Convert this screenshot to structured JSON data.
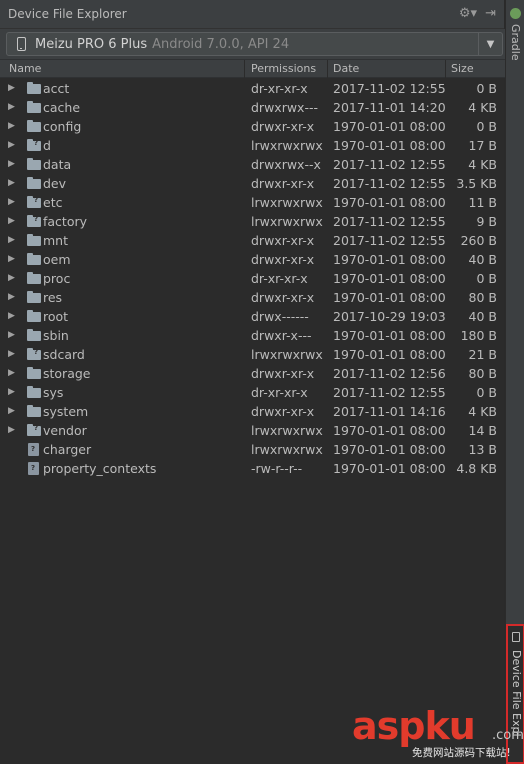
{
  "window": {
    "title": "Device File Explorer",
    "gear_icon": "⚙▾",
    "pin_icon": "⇥"
  },
  "device": {
    "name": "Meizu PRO 6 Plus",
    "version": "Android 7.0.0, API 24",
    "dropdown_icon": "▼"
  },
  "columns": {
    "name": "Name",
    "permissions": "Permissions",
    "date": "Date",
    "size": "Size"
  },
  "files": [
    {
      "name": "acct",
      "permissions": "dr-xr-xr-x",
      "date": "2017-11-02 12:55",
      "size": "0 B",
      "kind": "folder"
    },
    {
      "name": "cache",
      "permissions": "drwxrwx---",
      "date": "2017-11-01 14:20",
      "size": "4 KB",
      "kind": "folder"
    },
    {
      "name": "config",
      "permissions": "drwxr-xr-x",
      "date": "1970-01-01 08:00",
      "size": "0 B",
      "kind": "folder"
    },
    {
      "name": "d",
      "permissions": "lrwxrwxrwx",
      "date": "1970-01-01 08:00",
      "size": "17 B",
      "kind": "link"
    },
    {
      "name": "data",
      "permissions": "drwxrwx--x",
      "date": "2017-11-02 12:55",
      "size": "4 KB",
      "kind": "folder"
    },
    {
      "name": "dev",
      "permissions": "drwxr-xr-x",
      "date": "2017-11-02 12:55",
      "size": "3.5 KB",
      "kind": "folder"
    },
    {
      "name": "etc",
      "permissions": "lrwxrwxrwx",
      "date": "1970-01-01 08:00",
      "size": "11 B",
      "kind": "link"
    },
    {
      "name": "factory",
      "permissions": "lrwxrwxrwx",
      "date": "2017-11-02 12:55",
      "size": "9 B",
      "kind": "link"
    },
    {
      "name": "mnt",
      "permissions": "drwxr-xr-x",
      "date": "2017-11-02 12:55",
      "size": "260 B",
      "kind": "folder"
    },
    {
      "name": "oem",
      "permissions": "drwxr-xr-x",
      "date": "1970-01-01 08:00",
      "size": "40 B",
      "kind": "folder"
    },
    {
      "name": "proc",
      "permissions": "dr-xr-xr-x",
      "date": "1970-01-01 08:00",
      "size": "0 B",
      "kind": "folder"
    },
    {
      "name": "res",
      "permissions": "drwxr-xr-x",
      "date": "1970-01-01 08:00",
      "size": "80 B",
      "kind": "folder"
    },
    {
      "name": "root",
      "permissions": "drwx------",
      "date": "2017-10-29 19:03",
      "size": "40 B",
      "kind": "folder"
    },
    {
      "name": "sbin",
      "permissions": "drwxr-x---",
      "date": "1970-01-01 08:00",
      "size": "180 B",
      "kind": "folder"
    },
    {
      "name": "sdcard",
      "permissions": "lrwxrwxrwx",
      "date": "1970-01-01 08:00",
      "size": "21 B",
      "kind": "link"
    },
    {
      "name": "storage",
      "permissions": "drwxr-xr-x",
      "date": "2017-11-02 12:56",
      "size": "80 B",
      "kind": "folder"
    },
    {
      "name": "sys",
      "permissions": "dr-xr-xr-x",
      "date": "2017-11-02 12:55",
      "size": "0 B",
      "kind": "folder"
    },
    {
      "name": "system",
      "permissions": "drwxr-xr-x",
      "date": "2017-11-01 14:16",
      "size": "4 KB",
      "kind": "folder"
    },
    {
      "name": "vendor",
      "permissions": "lrwxrwxrwx",
      "date": "1970-01-01 08:00",
      "size": "14 B",
      "kind": "link"
    },
    {
      "name": "charger",
      "permissions": "lrwxrwxrwx",
      "date": "1970-01-01 08:00",
      "size": "13 B",
      "kind": "file"
    },
    {
      "name": "property_contexts",
      "permissions": "-rw-r--r--",
      "date": "1970-01-01 08:00",
      "size": "4.8 KB",
      "kind": "file"
    }
  ],
  "side_tabs": {
    "gradle": "Gradle",
    "device_file_explorer": "Device File Expl"
  },
  "watermark": {
    "brand": "aspku",
    "dotcom": ".com",
    "subtitle": "免费网站源码下载站!"
  }
}
